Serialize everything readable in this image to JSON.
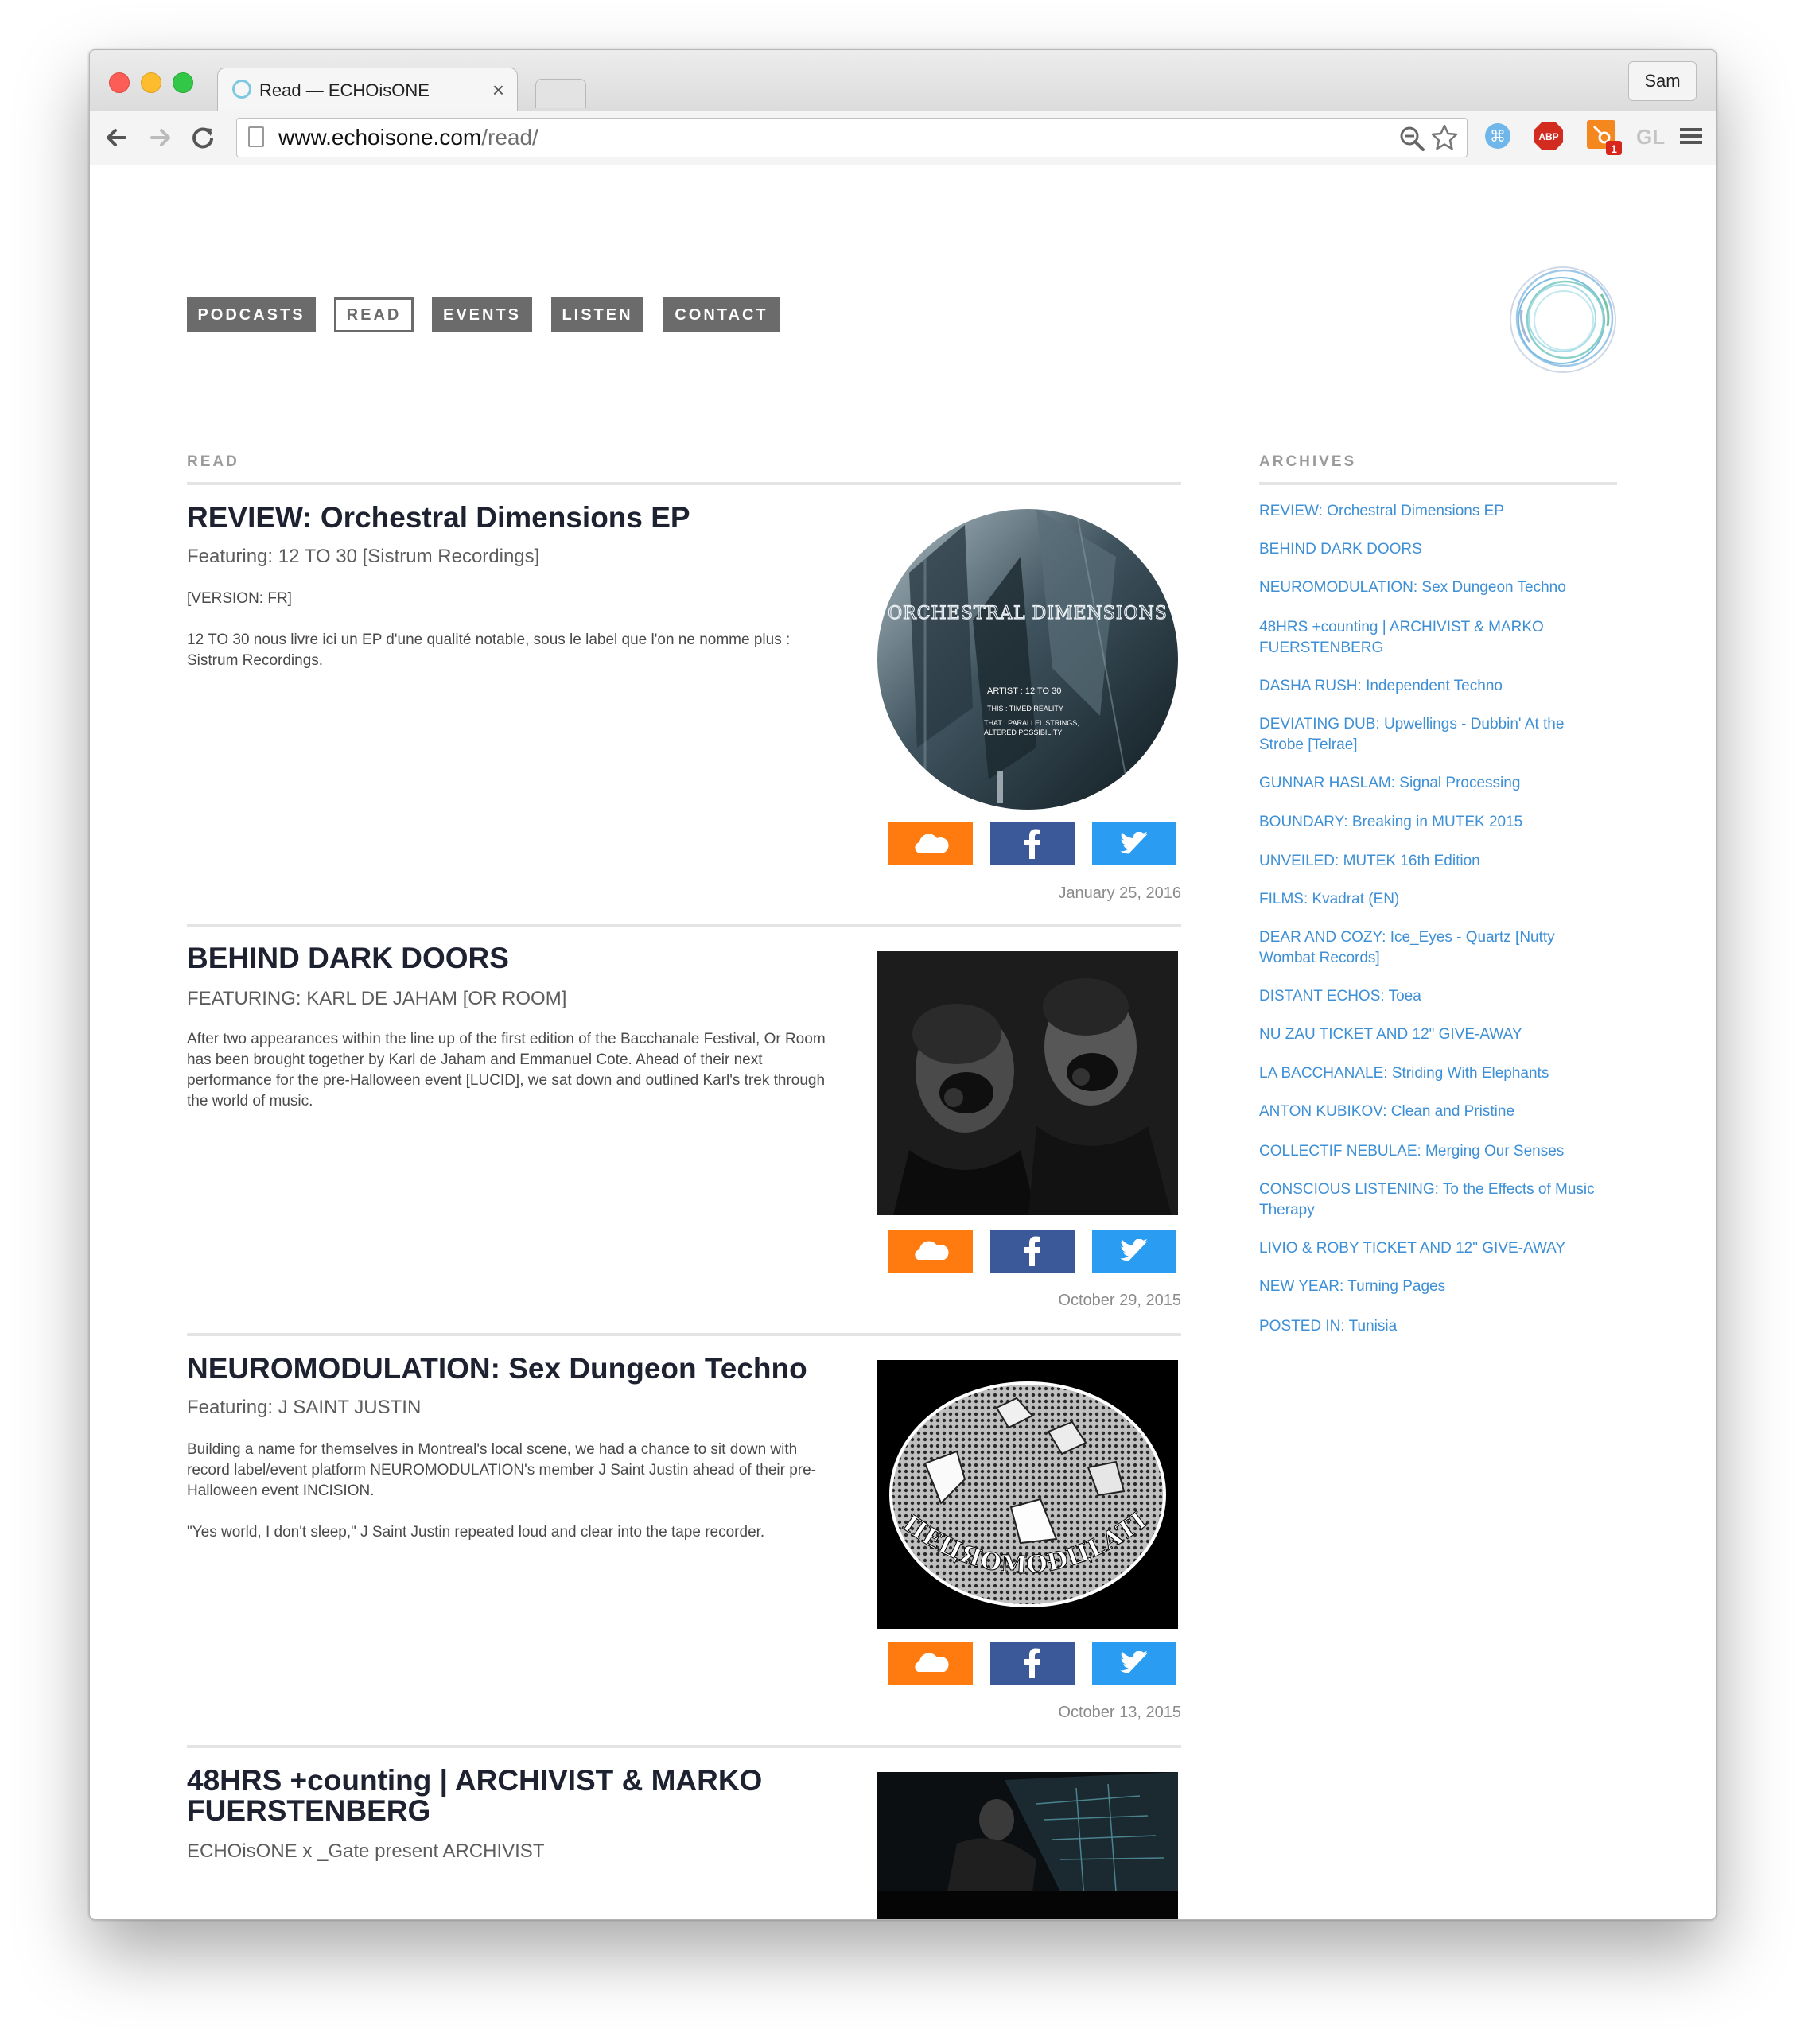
{
  "browser": {
    "tab_title": "Read — ECHOisONE",
    "tab_close": "×",
    "profile_name": "Sam",
    "url_host": "www.echoisone.com",
    "url_path": "/read/",
    "ext_abp": "ABP",
    "ext_badge": "1",
    "ext_gl": "GL"
  },
  "nav": {
    "items": [
      {
        "label": "PODCASTS"
      },
      {
        "label": "READ",
        "active": true
      },
      {
        "label": "EVENTS"
      },
      {
        "label": "LISTEN"
      },
      {
        "label": "CONTACT"
      }
    ]
  },
  "main": {
    "section_label": "READ",
    "posts": [
      {
        "title": "REVIEW: Orchestral Dimensions EP",
        "subtitle": "Featuring: 12 TO 30 [Sistrum Recordings]",
        "body": [
          "[VERSION: FR]",
          "12 TO 30 nous livre ici un EP d'une qualité notable, sous le label que l'on ne nomme plus : Sistrum Recordings."
        ],
        "date": "January 25, 2016",
        "image_text": {
          "title": "ORCHESTRAL DIMENSIONS",
          "artist": "ARTIST : 12 TO 30",
          "this": "THIS : TIMED REALITY",
          "that": "THAT : PARALLEL STRINGS,",
          "that2": "ALTERED POSSIBILITY"
        }
      },
      {
        "title": "BEHIND DARK DOORS",
        "subtitle": "FEATURING: KARL DE JAHAM [OR ROOM]",
        "body": [
          "After two appearances within the line up of the first edition of the Bacchanale Festival, Or Room has been brought together by Karl de Jaham and Emmanuel Cote. Ahead of their next performance for the pre-Halloween event [LUCID], we sat down and outlined Karl's trek through the world of music."
        ],
        "date": "October 29, 2015"
      },
      {
        "title": "NEUROMODULATION: Sex Dungeon Techno",
        "subtitle": "Featuring: J SAINT JUSTIN",
        "body": [
          "Building a name for themselves in Montreal's local scene, we had a chance to sit down with record label/event platform NEUROMODULATION's member J Saint Justin ahead of their pre-Halloween event INCISION.",
          "\"Yes world, I don't sleep,\" J Saint Justin repeated loud and clear into the tape recorder."
        ],
        "date": "October 13, 2015",
        "image_text": "ПЕЦЯОМОÐЦLATIOП"
      },
      {
        "title": "48HRS +counting | ARCHIVIST & MARKO FUERSTENBERG",
        "subtitle": "ECHOisONE x _Gate present ARCHIVIST",
        "body": []
      }
    ]
  },
  "archives": {
    "label": "ARCHIVES",
    "links": [
      "REVIEW: Orchestral Dimensions EP",
      "BEHIND DARK DOORS",
      "NEUROMODULATION: Sex Dungeon Techno",
      "48HRS +counting | ARCHIVIST & MARKO FUERSTENBERG",
      "DASHA RUSH: Independent Techno",
      "DEVIATING DUB: Upwellings - Dubbin' At the Strobe [Telrae]",
      "GUNNAR HASLAM: Signal Processing",
      "BOUNDARY: Breaking in MUTEK 2015",
      "UNVEILED: MUTEK 16th Edition",
      "FILMS: Kvadrat (EN)",
      "DEAR AND COZY: Ice_Eyes - Quartz [Nutty Wombat Records]",
      "DISTANT ECHOS: Toea",
      "NU ZAU TICKET AND 12\" GIVE-AWAY",
      "LA BACCHANALE: Striding With Elephants",
      "ANTON KUBIKOV: Clean and Pristine",
      "COLLECTIF NEBULAE: Merging Our Senses",
      "CONSCIOUS LISTENING: To the Effects of Music Therapy",
      "LIVIO & ROBY TICKET AND 12\" GIVE-AWAY",
      "NEW YEAR: Turning Pages",
      "POSTED IN: Tunisia"
    ]
  },
  "colors": {
    "nav_bg": "#6b6b6b",
    "link": "#3d8fd6",
    "soundcloud": "#ff7a0f",
    "facebook": "#3b5998",
    "twitter": "#2a9df2"
  },
  "icons": [
    "back-arrow-icon",
    "forward-arrow-icon",
    "reload-icon",
    "page-icon",
    "zoom-icon",
    "star-icon",
    "soundcloud-icon",
    "facebook-icon",
    "twitter-icon"
  ]
}
